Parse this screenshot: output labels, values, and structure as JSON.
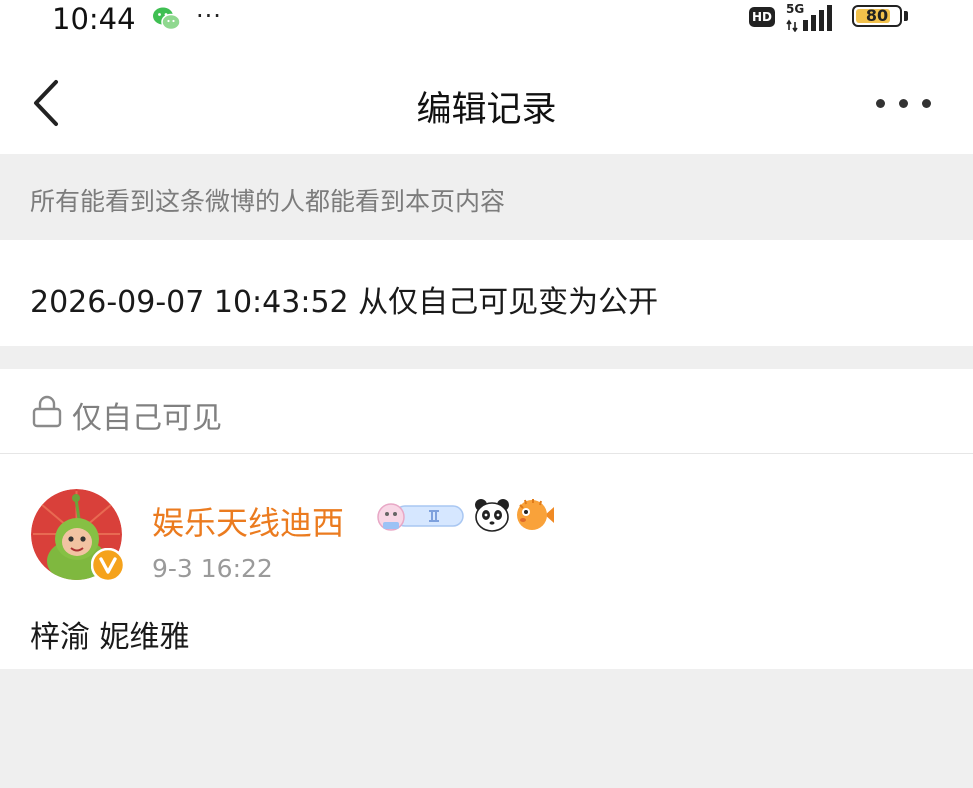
{
  "status_bar": {
    "time": "10:44",
    "dots": "···",
    "hd": "HD",
    "network": "5G",
    "battery": "80",
    "battery_level": 0.8
  },
  "header": {
    "title": "编辑记录"
  },
  "notice": "所有能看到这条微博的人都能看到本页内容",
  "record": {
    "text": "2026-09-07 10:43:52 从仅自己可见变为公开"
  },
  "visibility": {
    "label": "仅自己可见"
  },
  "post": {
    "username": "娱乐天线迪西",
    "time": "9-3 16:22",
    "content": "梓渝 妮维雅",
    "username_color": "#eb7b1f"
  },
  "icons": [
    "wechat-icon",
    "signal-icon",
    "back-icon",
    "more-icon",
    "lock-icon",
    "verified-icon",
    "level-badge-icon",
    "panda-icon",
    "pufferfish-icon"
  ]
}
